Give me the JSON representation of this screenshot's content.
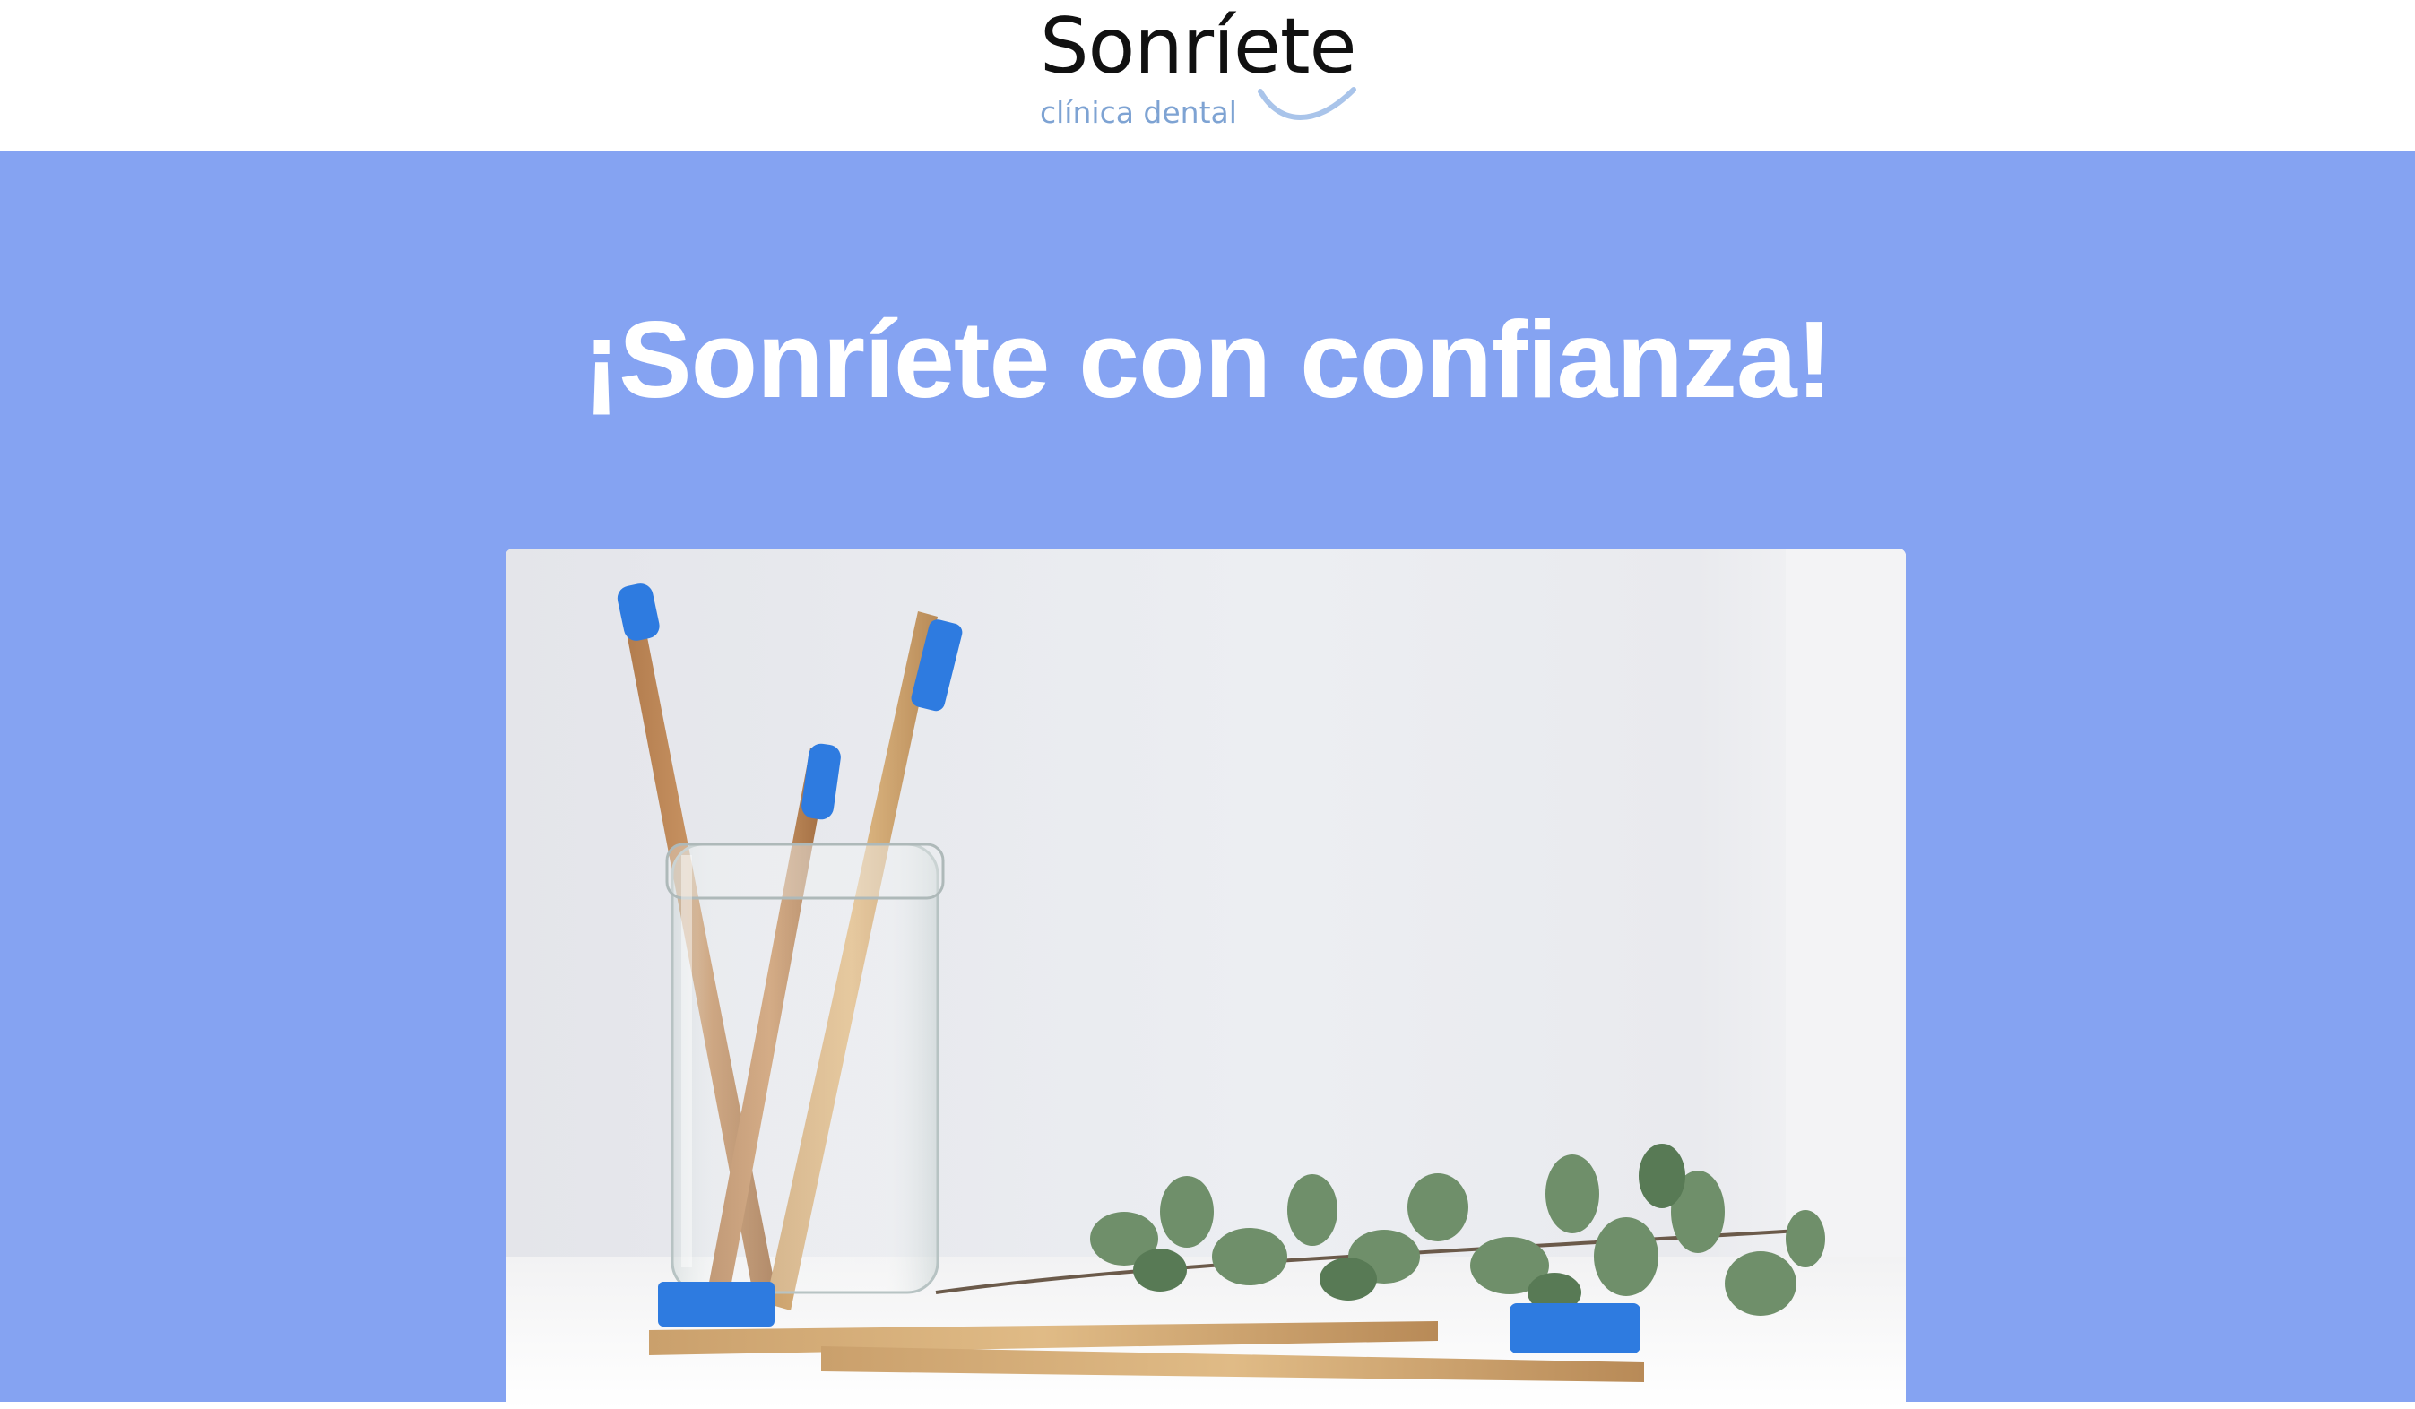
{
  "header": {
    "logo": {
      "title": "Sonríete",
      "subtitle": "clínica dental",
      "smile_icon": "smile-curve"
    }
  },
  "hero": {
    "title": "¡Sonríete con confianza!",
    "image": {
      "subject": "toothbrushes-jar-eucalyptus"
    }
  },
  "colors": {
    "hero_background": "#85a3f2",
    "header_background": "#ffffff",
    "logo_text": "#111111",
    "logo_subtitle": "#7ea3d3",
    "title_text": "#ffffff",
    "bristle_blue": "#2e7be0"
  }
}
